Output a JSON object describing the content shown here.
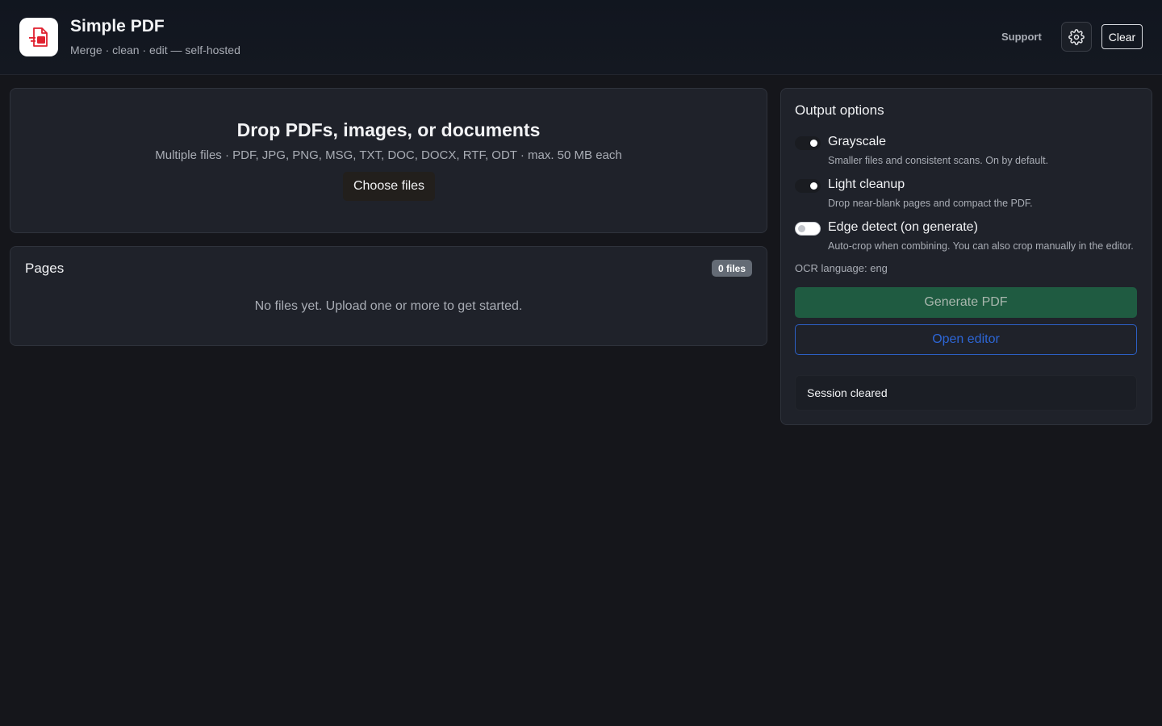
{
  "header": {
    "title": "Simple PDF",
    "subtitle": "Merge · clean · edit — self-hosted",
    "support_label": "Support",
    "clear_label": "Clear",
    "logo_icon": "pdf-file-icon",
    "settings_icon": "gear-icon"
  },
  "dropzone": {
    "title": "Drop PDFs, images, or documents",
    "subtitle": "Multiple files · PDF, JPG, PNG, MSG, TXT, DOC, DOCX, RTF, ODT · max. 50 MB each",
    "choose_label": "Choose files"
  },
  "pages": {
    "title": "Pages",
    "badge": "0 files",
    "empty_message": "No files yet. Upload one or more to get started."
  },
  "options": {
    "title": "Output options",
    "items": [
      {
        "label": "Grayscale",
        "description": "Smaller files and consistent scans. On by default.",
        "enabled": true
      },
      {
        "label": "Light cleanup",
        "description": "Drop near-blank pages and compact the PDF.",
        "enabled": true
      },
      {
        "label": "Edge detect (on generate)",
        "description": "Auto-crop when combining. You can also crop manually in the editor.",
        "enabled": false
      }
    ],
    "ocr_language": "OCR language: eng",
    "generate_label": "Generate PDF",
    "editor_label": "Open editor",
    "status": "Session cleared"
  },
  "colors": {
    "background": "#15161b",
    "panel": "#1f222a",
    "generate": "#1f5b41",
    "editor_outline": "#2c5fc4",
    "logo_red": "#e0202f"
  }
}
